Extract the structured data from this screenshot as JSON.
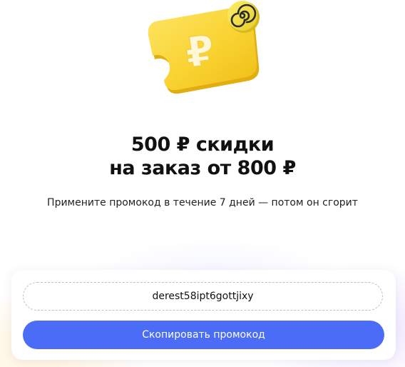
{
  "illustration": {
    "icon": "ruble-coupon-icon",
    "badge_icon": "spiral-logo-icon",
    "ruble_sign": "₽",
    "colors": {
      "ticket": "#f9d331",
      "ticket_shadow": "#e8b913",
      "badge": "#f4e04a",
      "badge_spiral": "#2b2b2b"
    }
  },
  "headline": {
    "line1": "500 ₽ скидки",
    "line2": "на заказ от 800 ₽"
  },
  "subtitle": "Примените промокод в течение 7 дней — потом он сгорит",
  "promo": {
    "code": "derest58ipt6gottjixy",
    "copy_button_label": "Скопировать промокод",
    "colors": {
      "button": "#4a6cf7",
      "button_text": "#ffffff",
      "field_border": "#bfbfc4"
    }
  }
}
